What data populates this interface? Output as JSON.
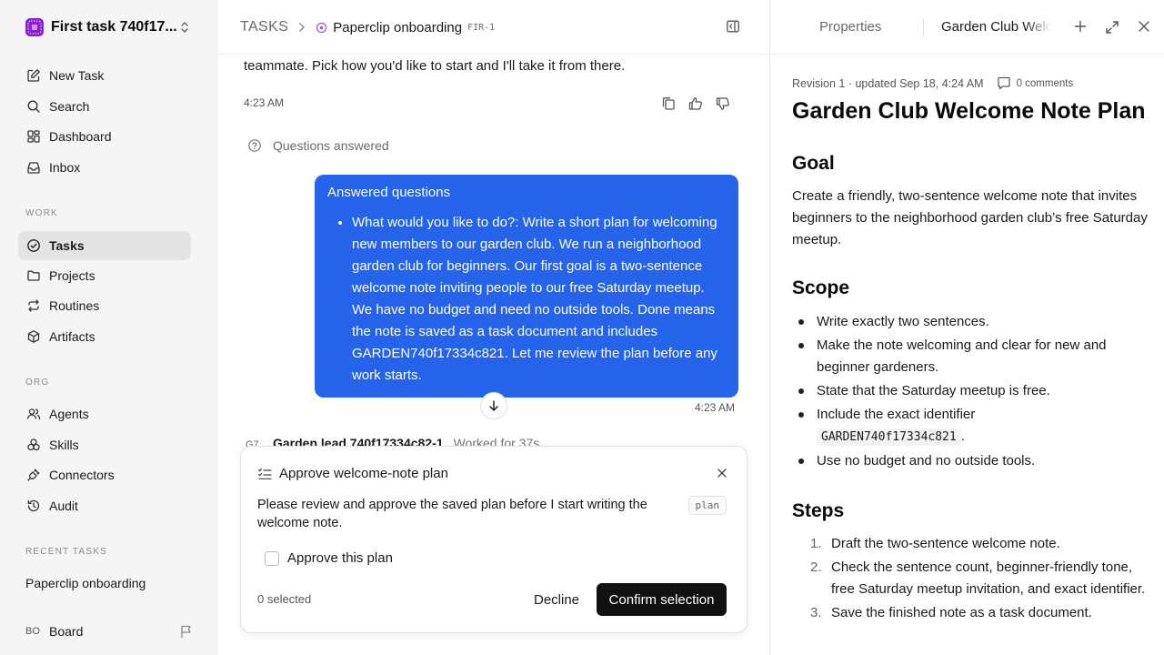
{
  "sidebar": {
    "workspace_name": "First task 740f17...",
    "nav_top": [
      {
        "label": "New Task",
        "icon": "edit-icon"
      },
      {
        "label": "Search",
        "icon": "search-icon"
      },
      {
        "label": "Dashboard",
        "icon": "dashboard-icon"
      },
      {
        "label": "Inbox",
        "icon": "inbox-icon"
      }
    ],
    "work_label": "WORK",
    "work_items": [
      {
        "label": "Tasks",
        "icon": "check-circle-icon",
        "active": true
      },
      {
        "label": "Projects",
        "icon": "folder-icon"
      },
      {
        "label": "Routines",
        "icon": "repeat-icon"
      },
      {
        "label": "Artifacts",
        "icon": "box-icon"
      }
    ],
    "org_label": "ORG",
    "org_items": [
      {
        "label": "Agents",
        "icon": "users-icon"
      },
      {
        "label": "Skills",
        "icon": "skills-icon"
      },
      {
        "label": "Connectors",
        "icon": "plug-icon"
      },
      {
        "label": "Audit",
        "icon": "history-icon"
      }
    ],
    "recent_label": "RECENT TASKS",
    "recent_task": "Paperclip onboarding",
    "board_initials": "BO",
    "board_label": "Board"
  },
  "header": {
    "root": "TASKS",
    "task_title": "Paperclip onboarding",
    "task_id": "FIR-1"
  },
  "chat": {
    "intro_text": "teammate. Pick how you'd like to start and I'll take it from there.",
    "intro_time": "4:23 AM",
    "questions_label": "Questions answered",
    "bubble_title": "Answered questions",
    "bubble_item": "What would you like to do?: Write a short plan for welcoming new members to our garden club. We run a neighborhood garden club for beginners. Our first goal is a two-sentence welcome note inviting people to our free Saturday meetup. We have no budget and need no outside tools. Done means the note is saved as a task document and includes GARDEN740f17334c821. Let me review the plan before any work starts.",
    "bubble_time": "4:23 AM",
    "agent_initials": "G7",
    "agent_name": "Garden lead 740f17334c82-1",
    "agent_meta": "Worked for 37s"
  },
  "approval": {
    "title": "Approve welcome-note plan",
    "description": "Please review and approve the saved plan before I start writing the welcome note.",
    "tag": "plan",
    "option_label": "Approve this plan",
    "option_checked": false,
    "selected_count": "0 selected",
    "decline_label": "Decline",
    "confirm_label": "Confirm selection"
  },
  "doc_panel": {
    "tab_properties": "Properties",
    "tab_document": "Garden Club Welcome Note Plan",
    "revision": "Revision 1 · updated Sep 18, 4:24 AM",
    "comments": "0 comments",
    "title": "Garden Club Welcome Note Plan",
    "goal_heading": "Goal",
    "goal_text": "Create a friendly, two-sentence welcome note that invites beginners to the neighborhood garden club’s free Saturday meetup.",
    "scope_heading": "Scope",
    "scope_items": [
      "Write exactly two sentences.",
      "Make the note welcoming and clear for new and beginner gardeners.",
      "State that the Saturday meetup is free.",
      "Include the exact identifier",
      "Use no budget and no outside tools."
    ],
    "scope_identifier": "GARDEN740f17334c821",
    "scope_identifier_suffix": ".",
    "steps_heading": "Steps",
    "steps": [
      {
        "n": "1.",
        "text": "Draft the two-sentence welcome note."
      },
      {
        "n": "2.",
        "text": "Check the sentence count, beginner-friendly tone, free Saturday meetup invitation, and exact identifier."
      },
      {
        "n": "3.",
        "text": "Save the finished note as a task document."
      }
    ]
  }
}
